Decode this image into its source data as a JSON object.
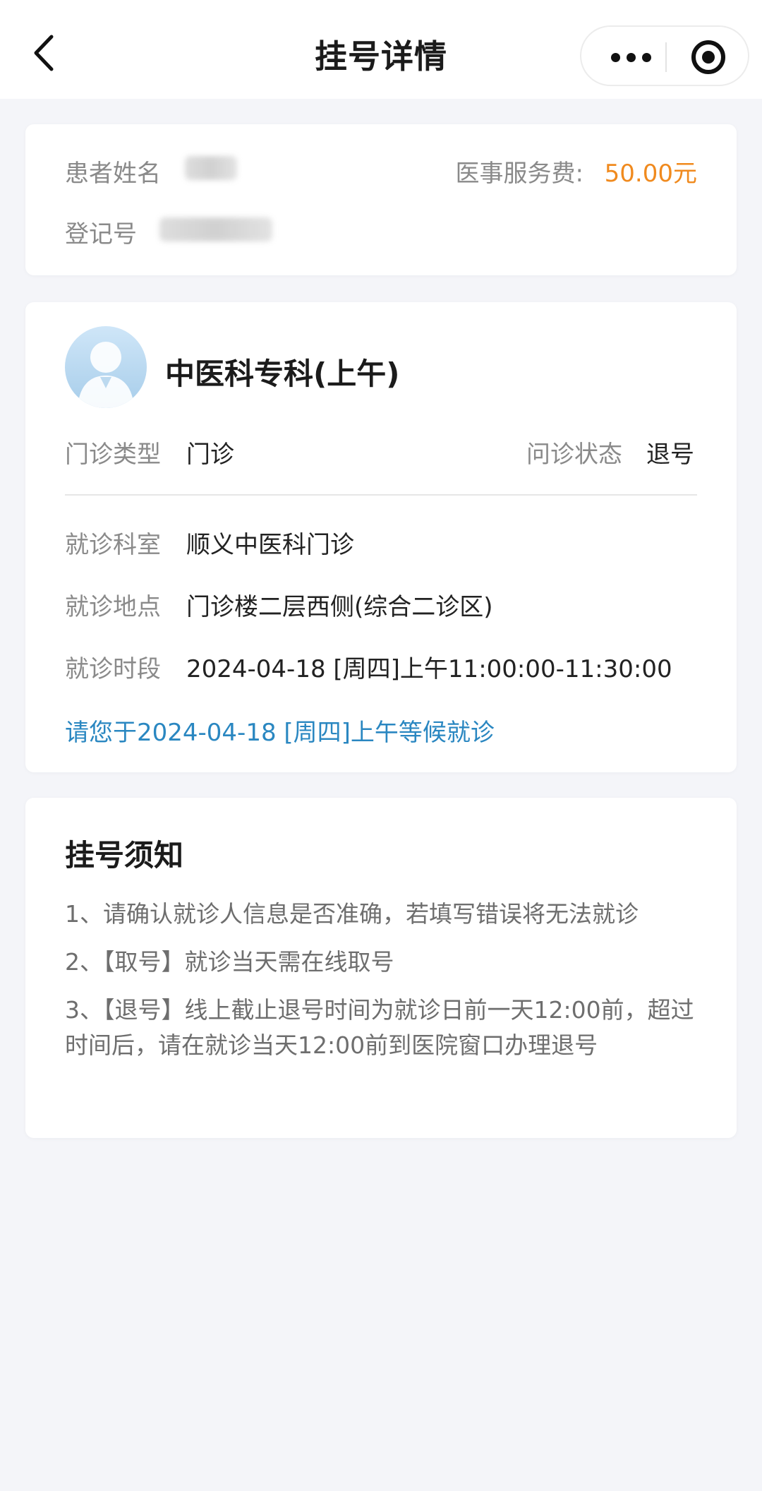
{
  "header": {
    "title": "挂号详情"
  },
  "patient_card": {
    "name_label": "患者姓名",
    "fee_label": "医事服务费:",
    "fee_value": "50.00元",
    "reg_label": "登记号"
  },
  "visit_card": {
    "department": "中医科专科(上午)",
    "type_label": "门诊类型",
    "type_value": "门诊",
    "status_label": "问诊状态",
    "status_value": "退号",
    "dept_label": "就诊科室",
    "dept_value": "顺义中医科门诊",
    "location_label": "就诊地点",
    "location_value": "门诊楼二层西侧(综合二诊区)",
    "time_label": "就诊时段",
    "time_value": "2024-04-18 [周四]上午11:00:00-11:30:00",
    "notice": "请您于2024-04-18 [周四]上午等候就诊"
  },
  "rules_card": {
    "title": "挂号须知",
    "items": [
      "1、请确认就诊人信息是否准确，若填写错误将无法就诊",
      "2、【取号】就诊当天需在线取号",
      "3、【退号】线上截止退号时间为就诊日前一天12:00前，超过时间后，请在就诊当天12:00前到医院窗口办理退号"
    ]
  },
  "colors": {
    "accent_orange": "#f08a1e",
    "accent_blue": "#2a87c1",
    "background": "#f4f5f9"
  },
  "icons": {
    "back": "chevron-left-icon",
    "more": "more-dots-icon",
    "close": "target-icon",
    "avatar": "doctor-avatar-icon"
  }
}
